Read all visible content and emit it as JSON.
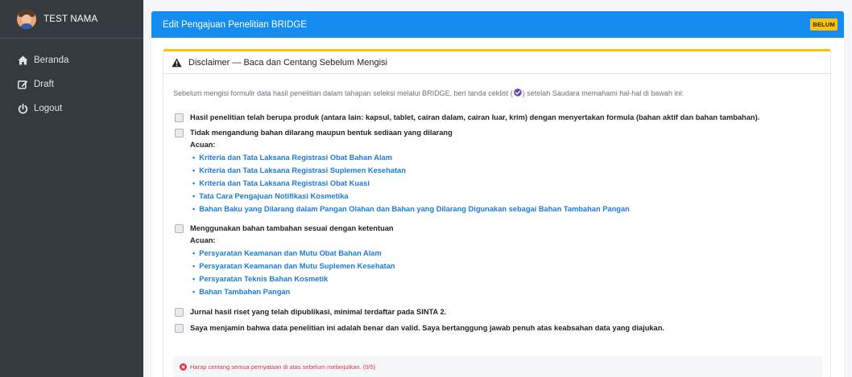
{
  "user": {
    "name": "TEST NAMA"
  },
  "nav": [
    {
      "label": "Beranda",
      "icon": "home-icon"
    },
    {
      "label": "Draft",
      "icon": "edit-icon"
    },
    {
      "label": "Logout",
      "icon": "power-icon"
    }
  ],
  "header": {
    "title": "Edit Pengajuan Penelitian BRIDGE",
    "status_badge": "BELUM"
  },
  "disclaimer": {
    "title": "Disclaimer — Baca dan Centang Sebelum Mengisi",
    "intro_before": "Sebelum mengisi formulir data hasil penelitian dalam tahapan seleksi melalui BRIDGE, beri tanda ceklist (",
    "intro_after": ") setelah Saudara memahami hal-hal di bawah ini:",
    "statements": [
      {
        "text": "Hasil penelitian telah berupa produk (antara lain: kapsul, tablet, cairan dalam, cairan luar, krim) dengan menyertakan formula (bahan aktif dan bahan tambahan).",
        "checked": false
      },
      {
        "text": "Tidak mengandung bahan dilarang maupun bentuk sediaan yang dilarang",
        "checked": false,
        "acuan_label": "Acuan:",
        "refs": [
          "Kriteria dan Tata Laksana Registrasi Obat Bahan Alam",
          "Kriteria dan Tata Laksana Registrasi Suplemen Kesehatan",
          "Kriteria dan Tata Laksana Registrasi Obat Kuasi",
          "Tata Cara Pengajuan Notifikasi Kosmetika",
          "Bahan Baku yang Dilarang dalam Pangan Olahan dan Bahan yang Dilarang Digunakan sebagai Bahan Tambahan Pangan"
        ]
      },
      {
        "text": "Menggunakan bahan tambahan sesuai dengan ketentuan",
        "checked": false,
        "acuan_label": "Acuan:",
        "refs": [
          "Persyaratan Keamanan dan Mutu Obat Bahan Alam",
          "Persyaratan Keamanan dan Mutu Suplemen Kesehatan",
          "Persyaratan Teknis Bahan Kosmetik",
          "Bahan Tambahan Pangan"
        ]
      },
      {
        "text": "Jurnal hasil riset yang telah dipublikasi, minimal terdaftar pada SINTA 2.",
        "checked": false
      },
      {
        "text": "Saya menjamin bahwa data penelitian ini adalah benar dan valid. Saya bertanggung jawab penuh atas keabsahan data yang diajukan.",
        "checked": false
      }
    ],
    "warning": "Harap centang semua pernyataan di atas sebelum melanjutkan. (0/5)"
  },
  "colors": {
    "sidebar": "#343a40",
    "header": "#158cf0",
    "badge": "#ffc107",
    "link": "#1a7cdc",
    "warning": "#dc3545"
  }
}
